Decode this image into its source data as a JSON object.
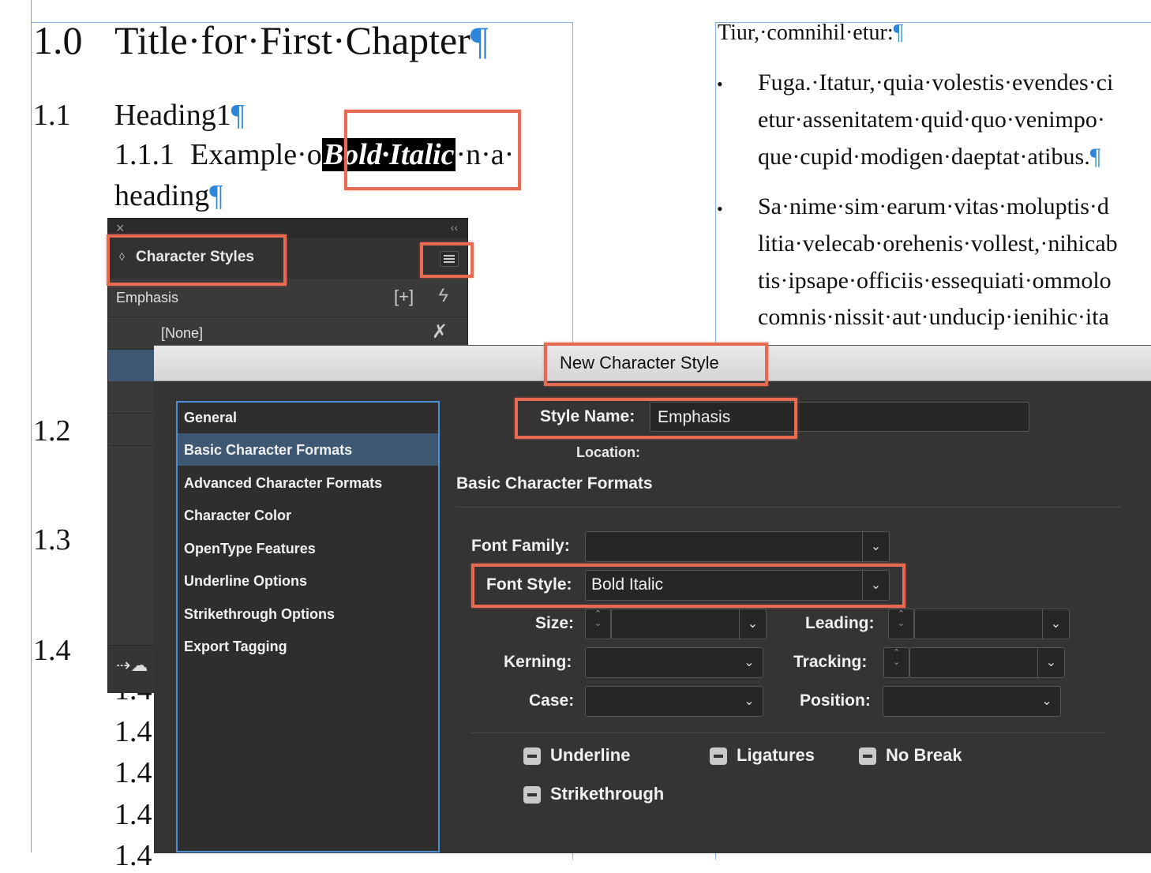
{
  "document": {
    "chapter": {
      "number": "1.0",
      "title": "Title·for·First·Chapter"
    },
    "heading1": {
      "number": "1.1",
      "title": "Heading1"
    },
    "heading2": {
      "number": "1.1.1",
      "pre": "Example·o",
      "bold_italic": "Bold·Italic",
      "post": "·n·a·",
      "line2": "heading"
    },
    "side_numbers": [
      "1.2",
      "1.3",
      "1.4"
    ],
    "lower_numbers": [
      "1.4",
      "1.4",
      "1.4",
      "1.4"
    ],
    "pilcrow": "¶",
    "right_column": {
      "line1": "Tiur,·comnihil·etur:",
      "bullet1": [
        "Fuga.·Itatur,·quia·volestis·evendes·ci",
        "etur·assenitatem·quid·quo·venimpo·",
        "que·cupid·modigen·daeptat·atibus."
      ],
      "bullet2": [
        "Sa·nime·sim·earum·vitas·moluptis·d",
        "litia·velecab·orehenis·vollest,·nihicab",
        "tis·ipsape·officiis·essequiati·ommolo",
        "comnis·nissit·aut·unducip·ienihic·ita"
      ]
    }
  },
  "character_styles_panel": {
    "close_icon": "×",
    "collapse_icon": "‹‹",
    "tab_label": "Character Styles",
    "group_name": "Emphasis",
    "none_item": "[None]"
  },
  "dialog": {
    "title": "New Character Style",
    "style_name_label": "Style Name:",
    "style_name_value": "Emphasis",
    "location_label": "Location:",
    "section_heading": "Basic Character Formats",
    "sidebar": [
      "General",
      "Basic Character Formats",
      "Advanced Character Formats",
      "Character Color",
      "OpenType Features",
      "Underline Options",
      "Strikethrough Options",
      "Export Tagging"
    ],
    "selected_sidebar": "Basic Character Formats",
    "font_family_label": "Font Family:",
    "font_family_value": "",
    "font_style_label": "Font Style:",
    "font_style_value": "Bold Italic",
    "size_label": "Size:",
    "leading_label": "Leading:",
    "kerning_label": "Kerning:",
    "tracking_label": "Tracking:",
    "case_label": "Case:",
    "position_label": "Position:",
    "checkboxes": [
      "Underline",
      "Ligatures",
      "No Break",
      "Strikethrough"
    ]
  },
  "colors": {
    "highlight": "#e86a52",
    "frame": "#8ab4e8",
    "pilcrow": "#2f86d9",
    "selected_row": "#3e5873"
  }
}
